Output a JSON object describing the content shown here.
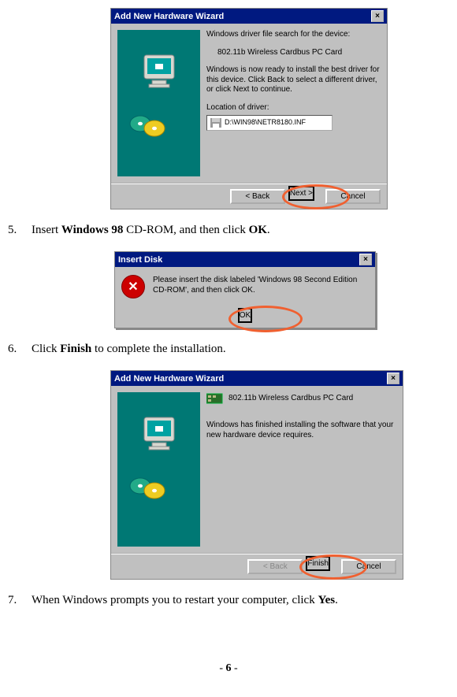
{
  "wizard1": {
    "title": "Add New Hardware Wizard",
    "line1": "Windows driver file search for the device:",
    "device": "802.11b Wireless Cardbus PC Card",
    "ready": "Windows is now ready to install the best driver for this device. Click Back to select a different driver, or click Next to continue.",
    "location_label": "Location of driver:",
    "location_value": "D:\\WIN98\\NETR8180.INF",
    "back": "< Back",
    "next": "Next >",
    "cancel": "Cancel"
  },
  "step5": {
    "num": "5.",
    "pre": "Insert ",
    "bold1": "Windows 98",
    "mid": " CD-ROM, and then click ",
    "bold2": "OK",
    "post": "."
  },
  "insert": {
    "title": "Insert Disk",
    "msg": "Please insert the disk labeled 'Windows 98 Second Edition CD-ROM', and then click OK.",
    "ok": "OK"
  },
  "step6": {
    "num": "6.",
    "pre": "Click ",
    "bold1": "Finish",
    "post": " to complete the installation."
  },
  "wizard3": {
    "title": "Add New Hardware Wizard",
    "device": "802.11b Wireless Cardbus PC Card",
    "done": "Windows has finished installing the software that your new hardware device requires.",
    "back": "< Back",
    "finish": "Finish",
    "cancel": "Cancel"
  },
  "step7": {
    "num": "7.",
    "pre": "When Windows prompts you to restart your computer, click ",
    "bold1": "Yes",
    "post": "."
  },
  "page": {
    "prefix": "- ",
    "num": "6",
    "suffix": " -"
  }
}
